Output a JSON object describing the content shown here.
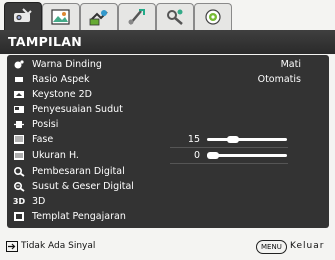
{
  "tabs": [
    {
      "name": "display",
      "icon": "display-icon",
      "active": true
    },
    {
      "name": "picture",
      "icon": "picture-icon",
      "active": false
    },
    {
      "name": "source",
      "icon": "source-icon",
      "active": false
    },
    {
      "name": "system-setup-basic",
      "icon": "system-setup-icon",
      "active": false
    },
    {
      "name": "system-setup-advanced",
      "icon": "advanced-setup-icon",
      "active": false
    },
    {
      "name": "information",
      "icon": "information-icon",
      "active": false
    }
  ],
  "header": {
    "title": "TAMPILAN"
  },
  "menu": {
    "items": [
      {
        "id": "warna-dinding",
        "icon": "wall-color-icon",
        "label": "Warna Dinding",
        "value": "Mati"
      },
      {
        "id": "rasio-aspek",
        "icon": "aspect-ratio-icon",
        "label": "Rasio Aspek",
        "value": "Otomatis"
      },
      {
        "id": "keystone-2d",
        "icon": "keystone-icon",
        "label": "Keystone 2D",
        "value": ""
      },
      {
        "id": "penyesuaian-sudut",
        "icon": "corner-fit-icon",
        "label": "Penyesuaian Sudut",
        "value": ""
      },
      {
        "id": "posisi",
        "icon": "position-icon",
        "label": "Posisi",
        "value": ""
      },
      {
        "id": "fase",
        "icon": "phase-icon",
        "label": "Fase",
        "value": "15",
        "slider": 0.3
      },
      {
        "id": "ukuran-h",
        "icon": "h-size-icon",
        "label": "Ukuran H.",
        "value": "0",
        "slider": 0.0
      },
      {
        "id": "pembesaran-digital",
        "icon": "digital-zoom-icon",
        "label": "Pembesaran Digital",
        "value": ""
      },
      {
        "id": "susut-geser-digital",
        "icon": "digital-shrink-icon",
        "label": "Susut & Geser Digital",
        "value": ""
      },
      {
        "id": "3d",
        "icon": "3d-icon",
        "icon_text": "3D",
        "label": "3D",
        "value": ""
      },
      {
        "id": "templat-pengajaran",
        "icon": "teaching-template-icon",
        "label": "Templat Pengajaran",
        "value": ""
      }
    ]
  },
  "footer": {
    "source_label": "Tidak Ada Sinyal",
    "menu_key": "MENU",
    "exit_label": "Keluar"
  },
  "colors": {
    "panel": "#333333",
    "header": "#2f2f2f",
    "background": "#f4f4f2"
  }
}
